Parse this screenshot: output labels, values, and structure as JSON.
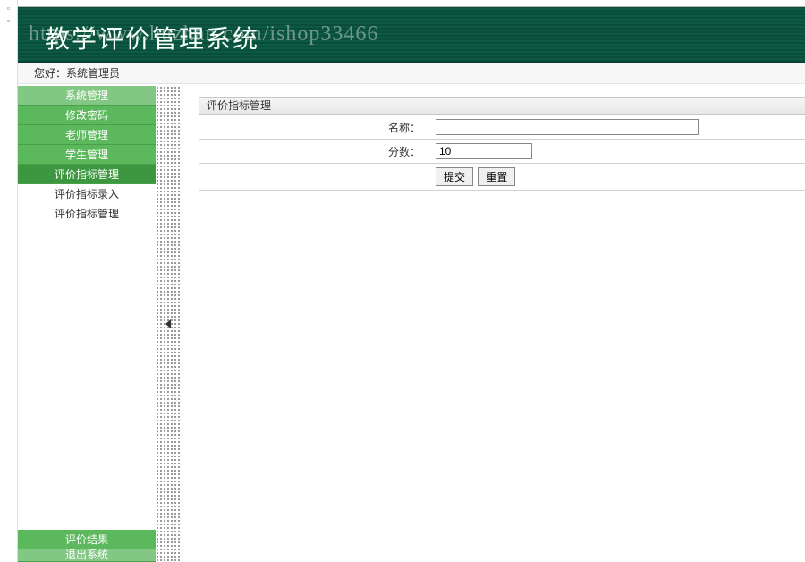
{
  "watermark": "https://www.huzhan.com/ishop33466",
  "header": {
    "title": "教学评价管理系统"
  },
  "greeting": {
    "prefix": "您好：",
    "user": "系统管理员"
  },
  "sidebar": {
    "items": [
      {
        "label": "系统管理"
      },
      {
        "label": "修改密码"
      },
      {
        "label": "老师管理"
      },
      {
        "label": "学生管理"
      },
      {
        "label": "评价指标管理"
      }
    ],
    "subitems": [
      {
        "label": "评价指标录入"
      },
      {
        "label": "评价指标管理"
      }
    ],
    "bottom": [
      {
        "label": "评价结果"
      },
      {
        "label": "退出系统"
      }
    ]
  },
  "panel": {
    "title": "评价指标管理",
    "form": {
      "name_label": "名称：",
      "name_value": "",
      "score_label": "分数：",
      "score_value": "10",
      "submit_label": "提交",
      "reset_label": "重置"
    }
  }
}
